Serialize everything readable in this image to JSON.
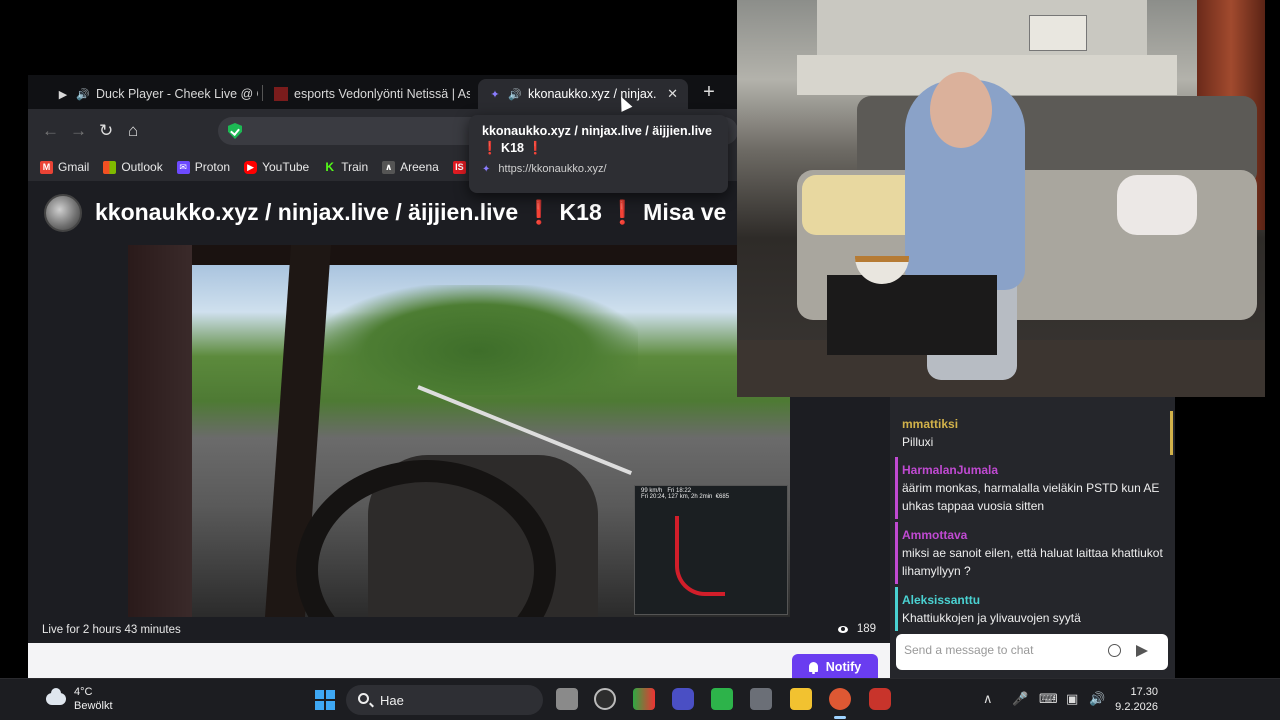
{
  "browser": {
    "tabs": [
      {
        "label": "Duck Player - Cheek Live @ Oly",
        "icon": "play-icon"
      },
      {
        "label": "esports Vedonlyönti Netissä | Asetu",
        "icon": "esports-favicon"
      },
      {
        "label": "kkonaukko.xyz / ninjax.live",
        "icon": "kick-favicon"
      }
    ],
    "active_tab_close": "✕",
    "new_tab": "+"
  },
  "bookmarks": [
    {
      "label": "Gmail",
      "icon": "gmail-icon",
      "color": "#ea4335"
    },
    {
      "label": "Outlook",
      "icon": "outlook-icon",
      "color": "#0078d4"
    },
    {
      "label": "Proton",
      "icon": "proton-icon",
      "color": "#6d4aff"
    },
    {
      "label": "YouTube",
      "icon": "youtube-icon",
      "color": "#ff0000"
    },
    {
      "label": "Train",
      "icon": "train-icon",
      "color": "#53fc18"
    },
    {
      "label": "Areena",
      "icon": "areena-icon",
      "color": "#555555"
    },
    {
      "label": "IS",
      "icon": "is-icon",
      "color": "#e11b22"
    }
  ],
  "stream": {
    "title_part1": "kkonaukko.xyz / ninjax.live / äijjien.live ",
    "title_excl1": "❗",
    "title_part2": " K18 ",
    "title_excl2": "❗",
    "title_part3": " Misa ve",
    "live_for": "Live for 2 hours 43 minutes",
    "viewers": "189",
    "notify_label": "Notify"
  },
  "tooltip": {
    "title_main": "kkonaukko.xyz / ninjax.live / äijjien.live",
    "title_excl1": "❗",
    "title_mid": " K18 ",
    "title_excl2": "❗",
    "url": "https://kkonaukko.xyz/"
  },
  "video_hud": {
    "speed": "99 km/h",
    "eta": "Fri 20:24, 127 km, 2h 2min",
    "time": "Fri 18:22",
    "money": "€685"
  },
  "chat": {
    "messages": [
      {
        "user": "mmattiksi",
        "text": "Pilluxi",
        "color": "#d2b24a"
      },
      {
        "user": "HarmalanJumala",
        "text": "äärim monkas, harmalalla vieläkin PSTD kun AE uhkas tappaa vuosia sitten",
        "color": "#c04ad2"
      },
      {
        "user": "Ammottava",
        "text": "miksi ae sanoit eilen, että haluat laittaa khattiukot lihamyllyyn ?",
        "color": "#c04ad2"
      },
      {
        "user": "Aleksissanttu",
        "text": "Khattiukkojen ja ylivauvojen syytä",
        "color": "#4ad2d2"
      }
    ],
    "input_placeholder": "Send a message to chat"
  },
  "taskbar": {
    "weather_temp": "4°C",
    "weather_desc": "Bewölkt",
    "search_label": "Hae",
    "time": "17.30",
    "date": "9.2.2026"
  }
}
